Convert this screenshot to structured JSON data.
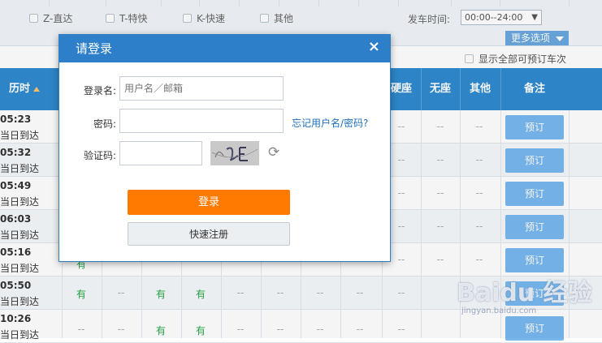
{
  "filters": {
    "train_types": [
      {
        "label": "Z-直达"
      },
      {
        "label": "T-特快"
      },
      {
        "label": "K-快速"
      },
      {
        "label": "其他"
      }
    ],
    "depart_time_label": "发车时间:",
    "depart_time_value": "00:00--24:00",
    "more_options": "更多选项",
    "show_all_bookable": "显示全部可预订车次"
  },
  "table": {
    "headers": {
      "duration": "历时",
      "hard_seat": "硬座",
      "no_seat": "无座",
      "other": "其他",
      "remark": "备注"
    },
    "rows": [
      {
        "duration": "05:23",
        "arrive": "当日到达",
        "mid": [
          "",
          "",
          "",
          ""
        ],
        "hard_seat": "--",
        "no_seat": "--",
        "other": "--",
        "book": "预订"
      },
      {
        "duration": "05:32",
        "arrive": "当日到达",
        "mid": [
          "",
          "",
          "",
          ""
        ],
        "hard_seat": "--",
        "no_seat": "--",
        "other": "--",
        "book": "预订"
      },
      {
        "duration": "05:49",
        "arrive": "当日到达",
        "mid": [
          "",
          "",
          "",
          ""
        ],
        "hard_seat": "--",
        "no_seat": "--",
        "other": "--",
        "book": "预订"
      },
      {
        "duration": "06:03",
        "arrive": "当日到达",
        "mid": [
          "",
          "",
          "",
          ""
        ],
        "hard_seat": "--",
        "no_seat": "--",
        "other": "--",
        "book": "预订"
      },
      {
        "duration": "05:16",
        "arrive": "当日到达",
        "mid": [
          "有",
          "",
          "",
          ""
        ],
        "hard_seat": "--",
        "no_seat": "--",
        "other": "--",
        "book": "预订"
      },
      {
        "duration": "05:50",
        "arrive": "当日到达",
        "mid": [
          "有",
          "--",
          "有",
          "有"
        ],
        "cells": [
          "--",
          "--",
          "--",
          "--",
          "--"
        ],
        "book": "预订"
      },
      {
        "duration": "10:26",
        "arrive": "当日到达",
        "mid": [
          "--",
          "--",
          "有",
          "有"
        ],
        "cells": [
          "--",
          "--",
          "--",
          "--",
          "--"
        ],
        "book": "预订"
      }
    ]
  },
  "login_modal": {
    "title": "请登录",
    "close_symbol": "×",
    "username_label": "登录名:",
    "username_placeholder": "用户名／邮箱",
    "password_label": "密码:",
    "forgot_link": "忘记用户名/密码?",
    "captcha_label": "验证码:",
    "captcha_text": "c2tE",
    "login_button": "登录",
    "register_button": "快速注册"
  },
  "watermark": {
    "brand": "Baidu 经验",
    "url": "jingyan.baidu.com"
  },
  "colors": {
    "header_blue": "#2f8bd0",
    "modal_header": "#2c7fc8",
    "login_orange": "#ff7a00",
    "book_button": "#78b8ef",
    "available_green": "#28a745"
  }
}
